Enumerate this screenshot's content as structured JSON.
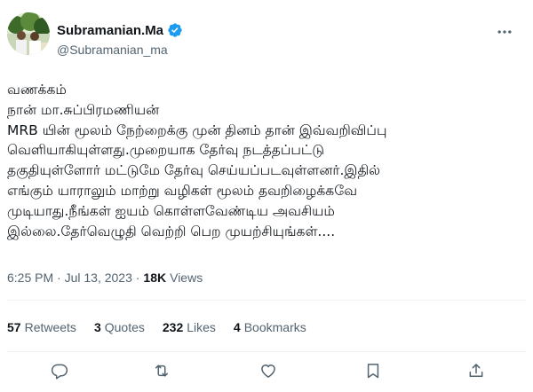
{
  "author": {
    "display_name": "Subramanian.Ma",
    "handle": "@Subramanian_ma",
    "avatar": "profile-photo",
    "verified": true,
    "verified_color": "#1d9bf0"
  },
  "tweet": {
    "lines": [
      "வணக்கம்",
      "நான் மா.சுப்பிரமணியன்",
      "MRB யின் மூலம் நேற்றைக்கு முன் தினம் தான் இவ்வறிவிப்பு",
      "வெளியாகியுள்ளது.முறையாக தேர்வு நடத்தப்பட்டு",
      "தகுதியுள்ளோர் மட்டுமே தேர்வு செய்யப்படவுள்ளனர்.இதில்",
      "எங்கும் யாராலும் மாற்று வழிகள் மூலம் தவறிழைக்கவே",
      "முடியாது.நீங்கள் ஐயம் கொள்ளவேண்டிய அவசியம்",
      "இல்லை.தேர்வெழுதி வெற்றி பெற முயற்சியுங்கள்...."
    ]
  },
  "meta": {
    "timestamp": "6:25 PM · Jul 13, 2023 ·",
    "views_count": "18K",
    "views_label": "Views"
  },
  "stats": {
    "retweets": {
      "count": "57",
      "label": "Retweets"
    },
    "quotes": {
      "count": "3",
      "label": "Quotes"
    },
    "likes": {
      "count": "232",
      "label": "Likes"
    },
    "bookmarks": {
      "count": "4",
      "label": "Bookmarks"
    }
  },
  "icons": {
    "more": "more-dots-icon",
    "reply": "reply-icon",
    "retweet": "retweet-icon",
    "like": "heart-icon",
    "bookmark": "bookmark-icon",
    "share": "share-icon"
  },
  "colors": {
    "text": "#0f1419",
    "secondary": "#536471",
    "divider": "#eff3f4",
    "verified": "#1d9bf0"
  }
}
